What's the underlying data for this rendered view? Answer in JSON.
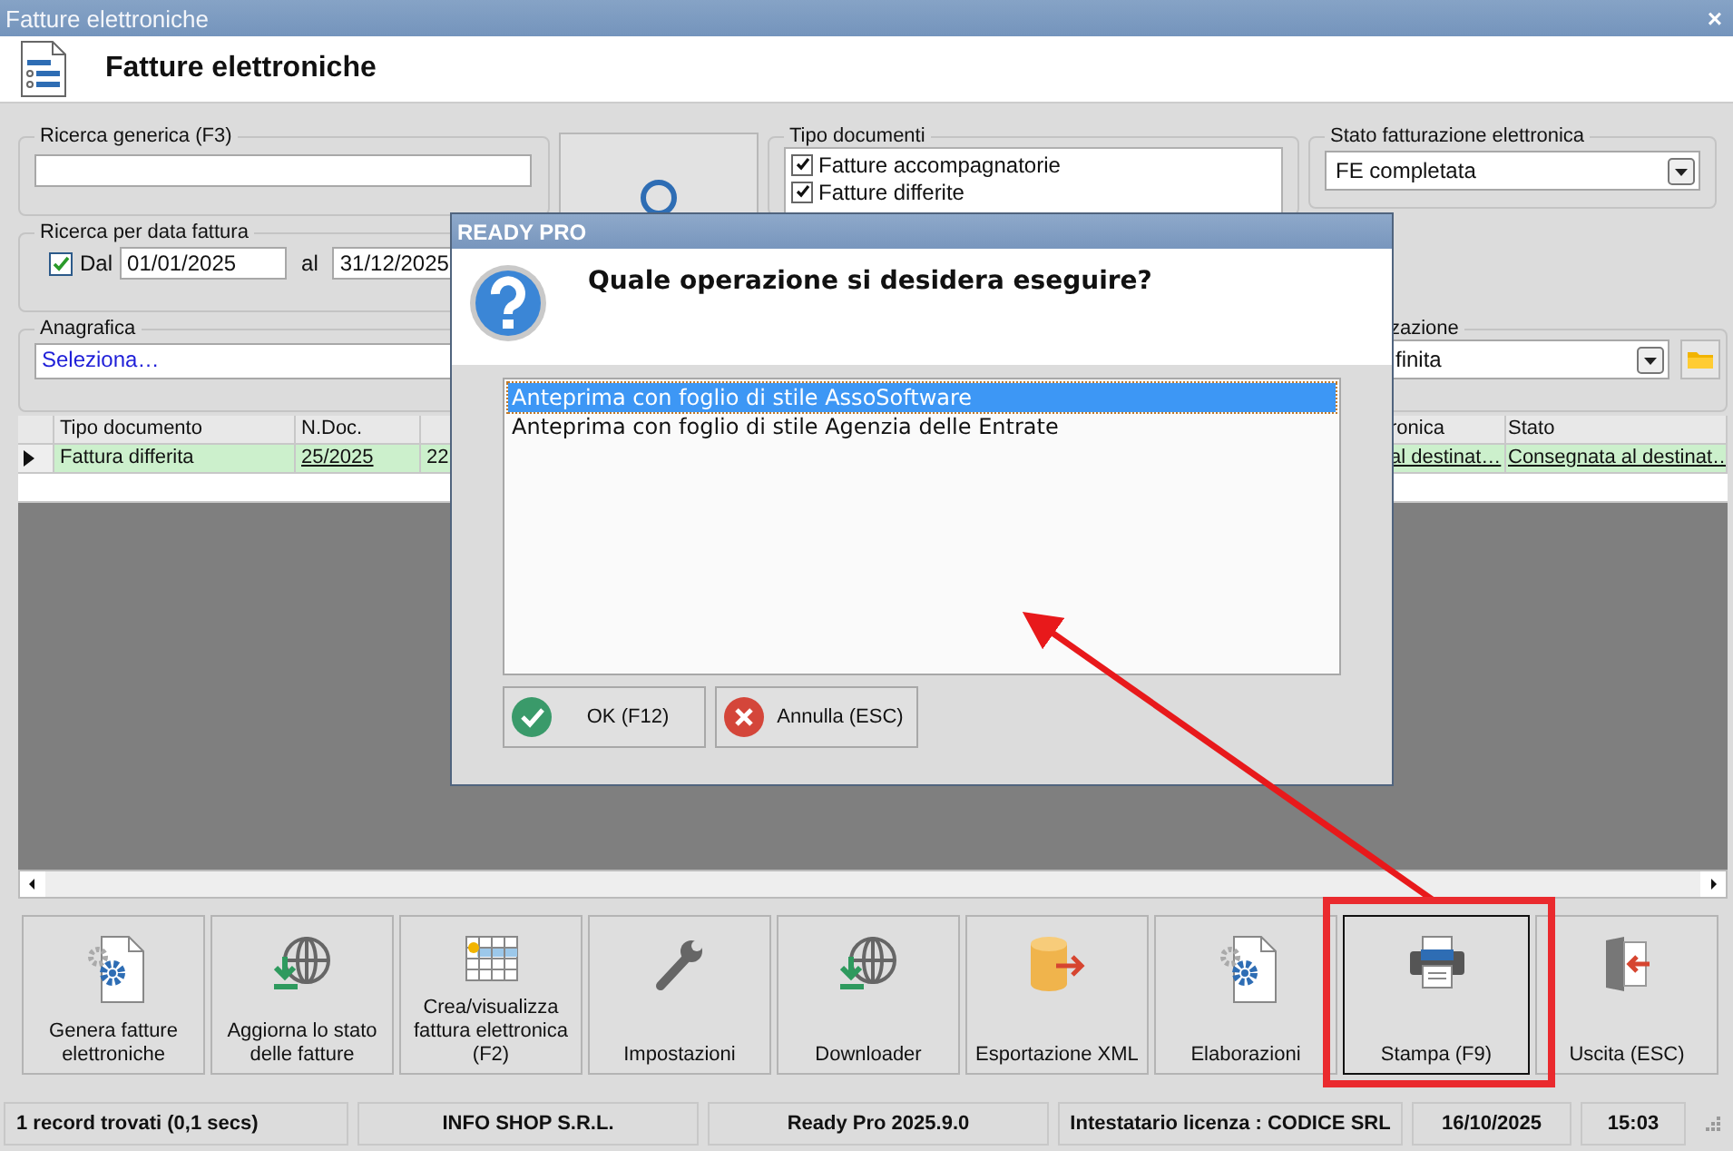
{
  "window": {
    "title": "Fatture elettroniche",
    "close": "×"
  },
  "header": {
    "title": "Fatture elettroniche"
  },
  "filters": {
    "generic_search": {
      "label": "Ricerca generica (F3)"
    },
    "date_search": {
      "label": "Ricerca per data fattura",
      "from_label": "Dal",
      "from_checked": true,
      "from": "01/01/2025",
      "to_label": "al",
      "to": "31/12/2025"
    },
    "document_types": {
      "label": "Tipo documenti",
      "items": [
        {
          "label": "Fatture accompagnatorie",
          "checked": true
        },
        {
          "label": "Fatture differite",
          "checked": true
        }
      ]
    },
    "status": {
      "label": "Stato fatturazione elettronica",
      "value": "FE completata"
    },
    "anagrafica": {
      "label": "Anagrafica",
      "value": "Seleziona…"
    },
    "view": {
      "label": "zazione",
      "value": "finita"
    }
  },
  "table": {
    "columns": {
      "tipo_documento": "Tipo documento",
      "n_doc": "N.Doc.",
      "column_4": "ronica",
      "stato": "Stato"
    },
    "rows": [
      {
        "tipo_documento": "Fattura differita",
        "n_doc": "25/2025",
        "column_3": "22",
        "column_4": "al destinat…",
        "stato": "Consegnata al destinat…",
        "current": true
      }
    ]
  },
  "toolbar": [
    {
      "label": "Genera fatture elettroniche",
      "kind": "generate",
      "focused": false
    },
    {
      "label": "Aggiorna lo stato delle fatture",
      "kind": "update",
      "focused": false
    },
    {
      "label": "Crea/visualizza fattura elettronica (F2)",
      "kind": "create",
      "focused": false
    },
    {
      "label": "Impostazioni",
      "kind": "settings",
      "focused": false
    },
    {
      "label": "Downloader",
      "kind": "download",
      "focused": false
    },
    {
      "label": "Esportazione XML",
      "kind": "export",
      "focused": false
    },
    {
      "label": "Elaborazioni",
      "kind": "process",
      "focused": false
    },
    {
      "label": "Stampa (F9)",
      "kind": "print",
      "focused": true
    },
    {
      "label": "Uscita (ESC)",
      "kind": "exit",
      "focused": false
    }
  ],
  "status_bar": [
    "1 record trovati (0,1 secs)",
    "INFO SHOP S.R.L.",
    "Ready Pro 2025.9.0",
    "Intestatario licenza : CODICE SRL",
    "16/10/2025",
    "15:03"
  ],
  "dialog": {
    "title": "READY PRO",
    "question": "Quale operazione si desidera eseguire?",
    "options": [
      {
        "label": "Anteprima con foglio di stile AssoSoftware",
        "selected": true
      },
      {
        "label": "Anteprima con foglio di stile Agenzia delle Entrate",
        "selected": false
      }
    ],
    "buttons": [
      {
        "label": "OK (F12)",
        "kind": "ok"
      },
      {
        "label": "Annulla (ESC)",
        "kind": "cancel"
      }
    ]
  }
}
